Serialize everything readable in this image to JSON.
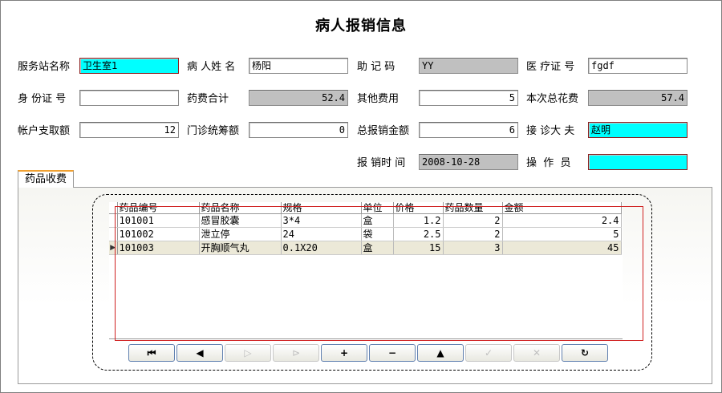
{
  "title": "病人报销信息",
  "fields": {
    "station_label": "服务站名称",
    "station_value": "卫生室1",
    "patient_label": "病 人姓 名",
    "patient_value": "杨阳",
    "mnemonic_label": "助 记 码",
    "mnemonic_value": "YY",
    "medcard_label": "医 疗证 号",
    "medcard_value": "fgdf",
    "idcard_label": "身 份证 号",
    "idcard_value": "",
    "drugtotal_label": "药费合计",
    "drugtotal_value": "52.4",
    "other_label": "其他费用",
    "other_value": "5",
    "total_label": "本次总花费",
    "total_value": "57.4",
    "account_label": "帐户支取额",
    "account_value": "12",
    "outpatient_label": "门诊统筹额",
    "outpatient_value": "0",
    "reimburse_label": "总报销金额",
    "reimburse_value": "6",
    "doctor_label": "接 诊大 夫",
    "doctor_value": "赵明",
    "time_label": "报 销时 间",
    "time_value": "2008-10-28",
    "operator_label": "操  作  员",
    "operator_value": ""
  },
  "tab": {
    "label": "药品收费"
  },
  "grid": {
    "headers": [
      "药品编号",
      "药品名称",
      "规格",
      "单位",
      "价格",
      "药品数量",
      "金额"
    ],
    "rows": [
      {
        "code": "101001",
        "name": "感冒胶囊",
        "spec": "3*4",
        "unit": "盒",
        "price": "1.2",
        "qty": "2",
        "amount": "2.4"
      },
      {
        "code": "101002",
        "name": "泄立停",
        "spec": "24",
        "unit": "袋",
        "price": "2.5",
        "qty": "2",
        "amount": "5"
      },
      {
        "code": "101003",
        "name": "开胸顺气丸",
        "spec": "0.1X20",
        "unit": "盒",
        "price": "15",
        "qty": "3",
        "amount": "45"
      }
    ],
    "current_row_indicator": "▶"
  },
  "navigator": {
    "first": "⏮",
    "prior": "◀",
    "next": "▷",
    "last": "⊳",
    "insert": "+",
    "delete": "−",
    "edit": "▲",
    "post": "✓",
    "cancel": "✕",
    "refresh": "↻"
  },
  "colors": {
    "highlight": "#00ffff",
    "readonly": "#c0c0c0",
    "selected_row": "#ece9d8",
    "tab_accent": "#f0a030"
  }
}
